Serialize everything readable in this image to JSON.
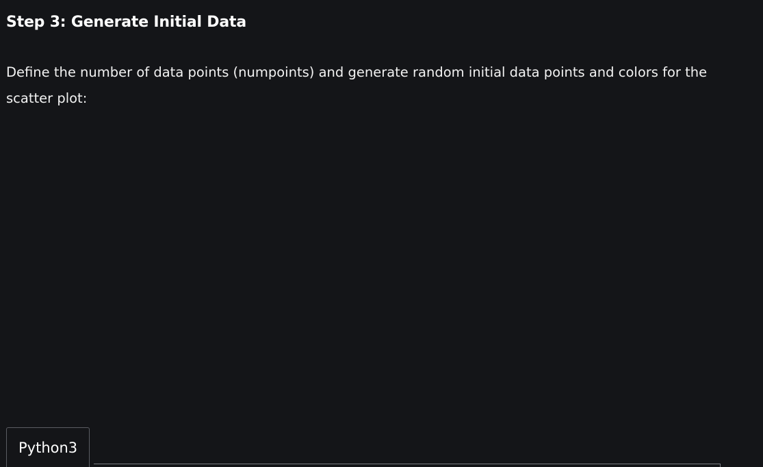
{
  "article": {
    "heading": "Step 3: Generate Initial Data",
    "paragraph": "Define the number of data points (numpoints) and generate random initial data points and colors for the scatter plot:"
  },
  "code_block": {
    "tabs": [
      {
        "label": "Python3",
        "active": true
      }
    ]
  },
  "colors": {
    "background": "#141518",
    "text": "#ffffff",
    "border": "#5b5d63"
  }
}
